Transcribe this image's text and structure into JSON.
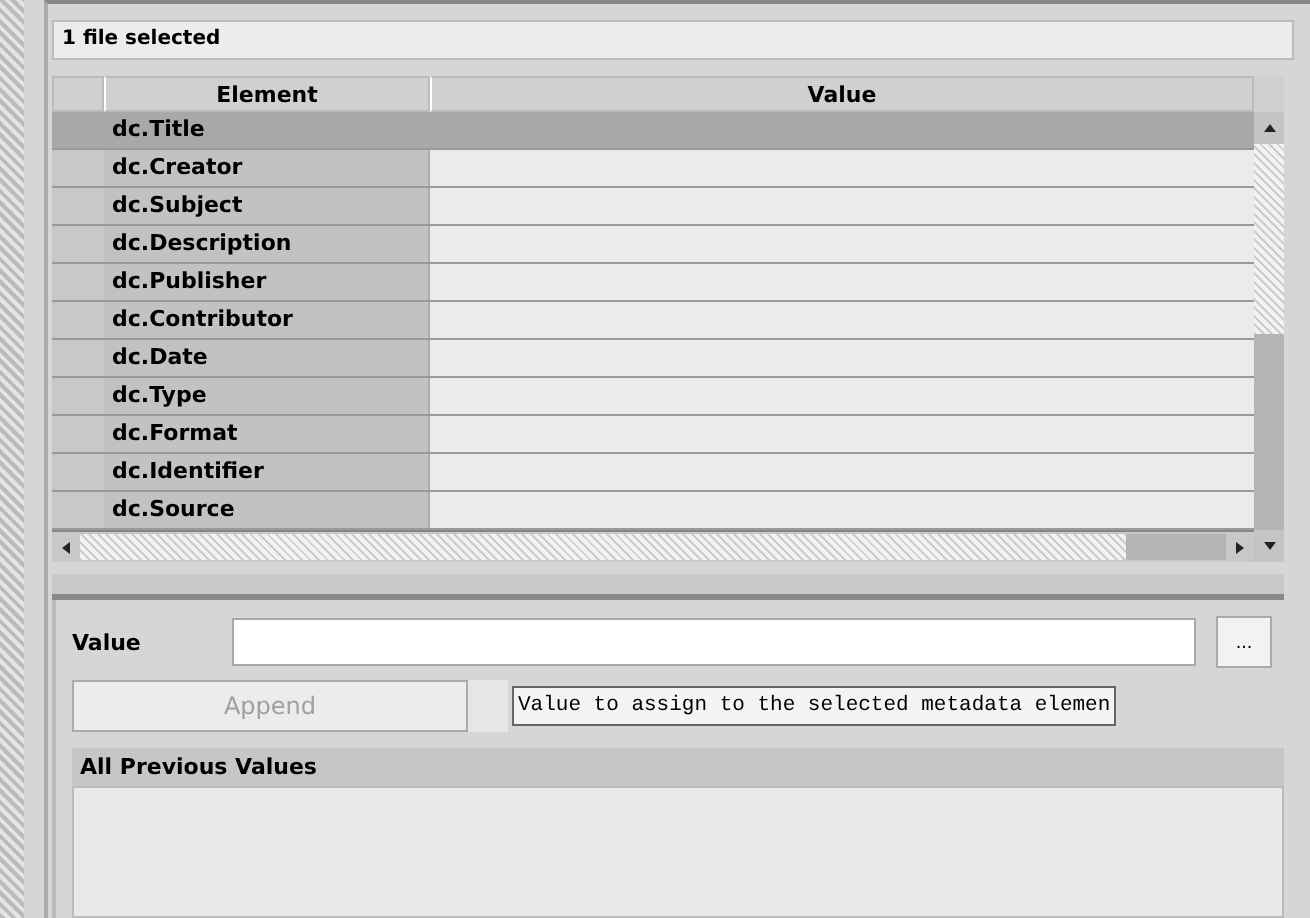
{
  "status": "1 file selected",
  "table": {
    "columns": [
      "Element",
      "Value"
    ],
    "rows": [
      {
        "element": "dc.Title",
        "selected": true
      },
      {
        "element": "dc.Creator",
        "selected": false
      },
      {
        "element": "dc.Subject",
        "selected": false
      },
      {
        "element": "dc.Description",
        "selected": false
      },
      {
        "element": "dc.Publisher",
        "selected": false
      },
      {
        "element": "dc.Contributor",
        "selected": false
      },
      {
        "element": "dc.Date",
        "selected": false
      },
      {
        "element": "dc.Type",
        "selected": false
      },
      {
        "element": "dc.Format",
        "selected": false
      },
      {
        "element": "dc.Identifier",
        "selected": false
      },
      {
        "element": "dc.Source",
        "selected": false
      }
    ]
  },
  "editor": {
    "label": "Value",
    "browse_button": "...",
    "append_button": {
      "label": "Append",
      "disabled": true
    },
    "tooltip": "Value to assign to the selected metadata elemen",
    "previous_values_title": "All Previous Values"
  }
}
